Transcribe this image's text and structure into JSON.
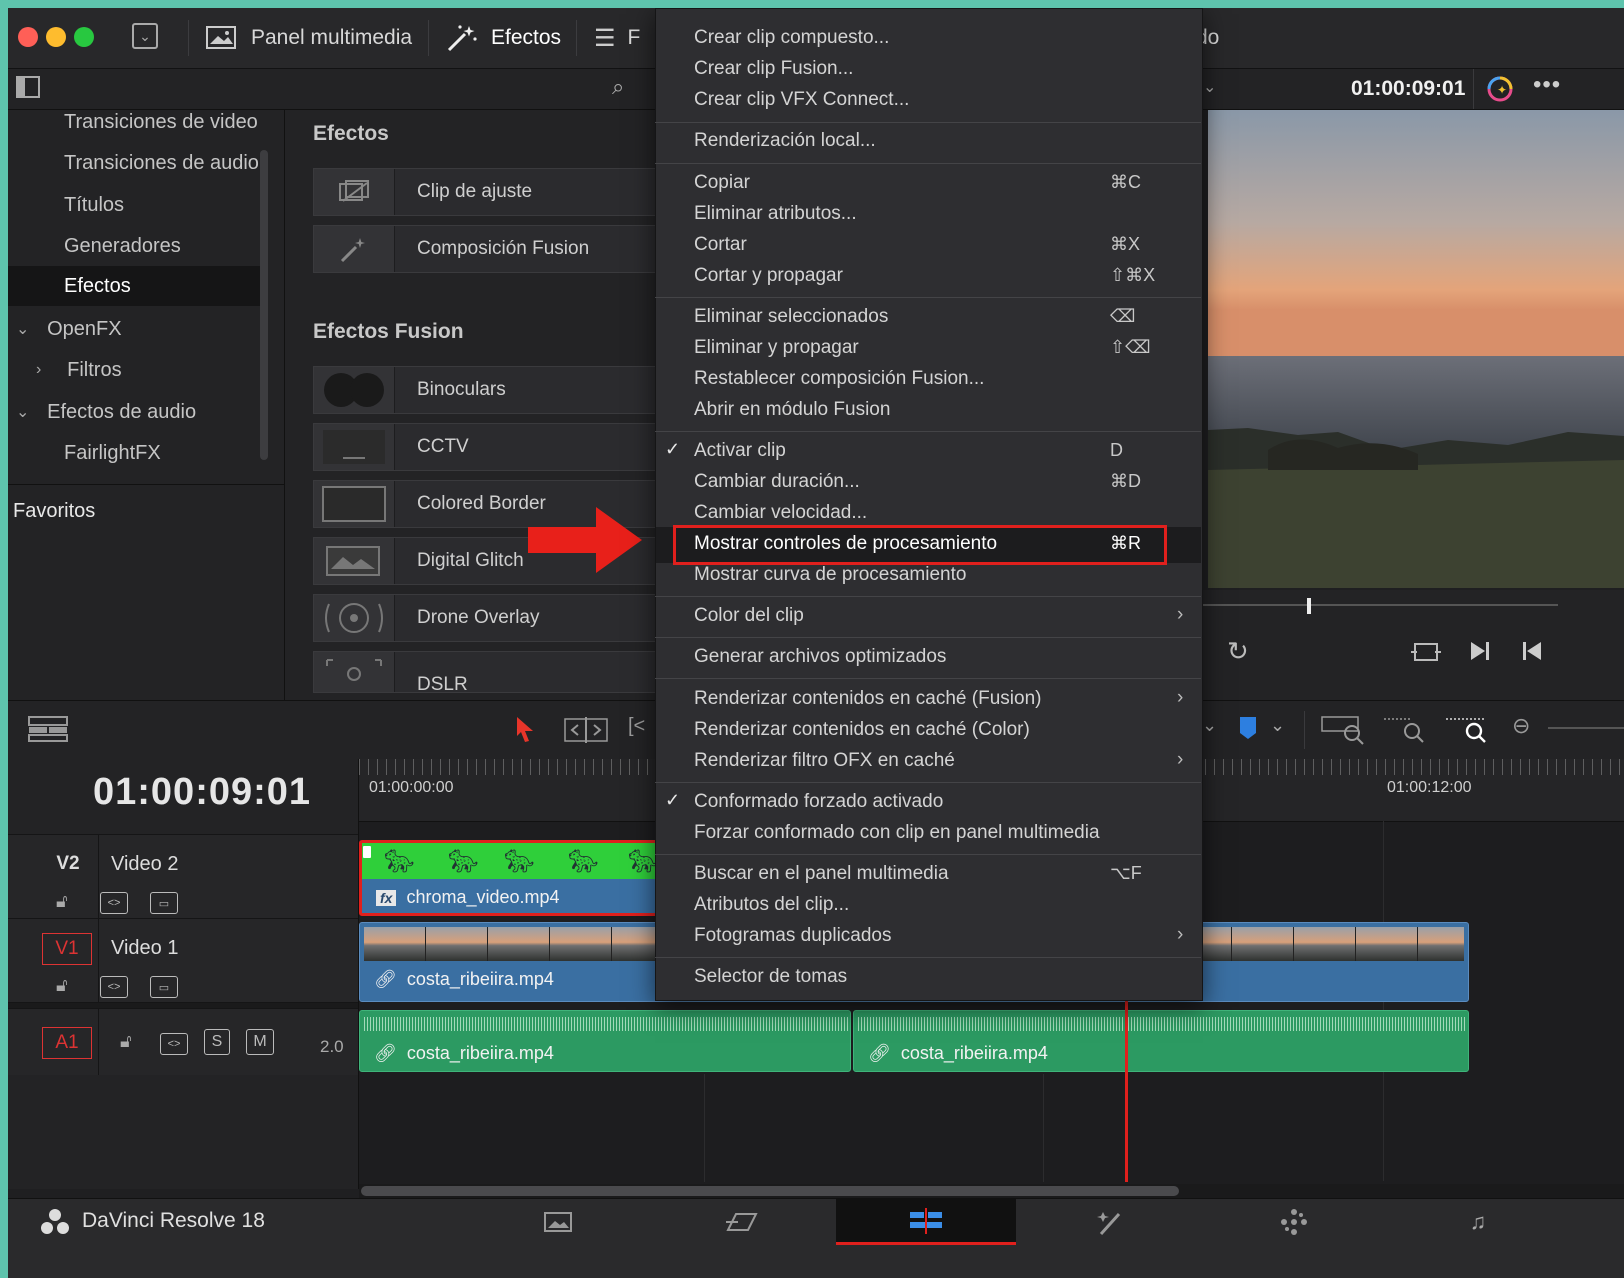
{
  "toolbar": {
    "media_pool_label": "Panel multimedia",
    "effects_label": "Efectos",
    "index_partial": "F",
    "right_partial": "do"
  },
  "viewer": {
    "timecode": "01:00:09:01"
  },
  "sidebar": {
    "items": [
      {
        "label": "Transiciones de video"
      },
      {
        "label": "Transiciones de audio"
      },
      {
        "label": "Títulos"
      },
      {
        "label": "Generadores"
      },
      {
        "label": "Efectos"
      },
      {
        "label": "OpenFX"
      },
      {
        "label": "Filtros"
      },
      {
        "label": "Efectos de audio"
      },
      {
        "label": "FairlightFX"
      }
    ],
    "favorites": "Favoritos"
  },
  "effects_panel": {
    "section1": "Efectos",
    "section1_items": [
      "Clip de ajuste",
      "Composición Fusion"
    ],
    "section2": "Efectos Fusion",
    "section2_items": [
      "Binoculars",
      "CCTV",
      "Colored Border",
      "Digital Glitch",
      "Drone Overlay",
      "DSLR"
    ]
  },
  "timeline": {
    "timecode": "01:00:09:01",
    "ruler_start": "01:00:00:00",
    "ruler_end": "01:00:12:00",
    "tracks": {
      "v2": {
        "tag": "V2",
        "name": "Video 2"
      },
      "v1": {
        "tag": "V1",
        "name": "Video 1"
      },
      "a1": {
        "tag": "A1",
        "solo": "S",
        "mute": "M",
        "level": "2.0"
      }
    },
    "clips": {
      "chroma": "chroma_video.mp4",
      "video1": "costa_ribeiira.mp4",
      "audio1": "costa_ribeiira.mp4",
      "audio2": "costa_ribeiira.mp4",
      "fx_badge": "fx"
    }
  },
  "context_menu": {
    "items": [
      {
        "label": "Crear clip compuesto...",
        "shortcut": ""
      },
      {
        "label": "Crear clip Fusion...",
        "shortcut": ""
      },
      {
        "label": "Crear clip VFX Connect...",
        "shortcut": ""
      },
      {
        "label": "Renderización local...",
        "shortcut": ""
      },
      {
        "label": "Copiar",
        "shortcut": "⌘C"
      },
      {
        "label": "Eliminar atributos...",
        "shortcut": ""
      },
      {
        "label": "Cortar",
        "shortcut": "⌘X"
      },
      {
        "label": "Cortar y propagar",
        "shortcut": "⇧⌘X"
      },
      {
        "label": "Eliminar seleccionados",
        "shortcut": "⌫"
      },
      {
        "label": "Eliminar y propagar",
        "shortcut": "⇧⌫"
      },
      {
        "label": "Restablecer composición Fusion...",
        "shortcut": ""
      },
      {
        "label": "Abrir en módulo Fusion",
        "shortcut": ""
      },
      {
        "label": "Activar clip",
        "shortcut": "D"
      },
      {
        "label": "Cambiar duración...",
        "shortcut": "⌘D"
      },
      {
        "label": "Cambiar velocidad...",
        "shortcut": ""
      },
      {
        "label": "Mostrar controles de procesamiento",
        "shortcut": "⌘R"
      },
      {
        "label": "Mostrar curva de procesamiento",
        "shortcut": ""
      },
      {
        "label": "Color del clip",
        "shortcut": ""
      },
      {
        "label": "Generar archivos optimizados",
        "shortcut": ""
      },
      {
        "label": "Renderizar contenidos en caché (Fusion)",
        "shortcut": ""
      },
      {
        "label": "Renderizar contenidos en caché (Color)",
        "shortcut": ""
      },
      {
        "label": "Renderizar filtro OFX en caché",
        "shortcut": ""
      },
      {
        "label": "Conformado forzado activado",
        "shortcut": ""
      },
      {
        "label": "Forzar conformado con clip en panel multimedia",
        "shortcut": ""
      },
      {
        "label": "Buscar en el panel multimedia",
        "shortcut": "⌥F"
      },
      {
        "label": "Atributos del clip...",
        "shortcut": ""
      },
      {
        "label": "Fotogramas duplicados",
        "shortcut": ""
      },
      {
        "label": "Selector de tomas",
        "shortcut": ""
      }
    ],
    "check_glyph": "✓",
    "submenu_glyph": "›"
  },
  "bottom": {
    "app_name": "DaVinci Resolve 18"
  },
  "colors": {
    "highlight_box": "#e0201d",
    "arrow": "#e8201a",
    "chroma_green": "#2fcf3a",
    "video_clip_blue": "#3a6fa2",
    "audio_clip_green": "#2c9a62"
  }
}
